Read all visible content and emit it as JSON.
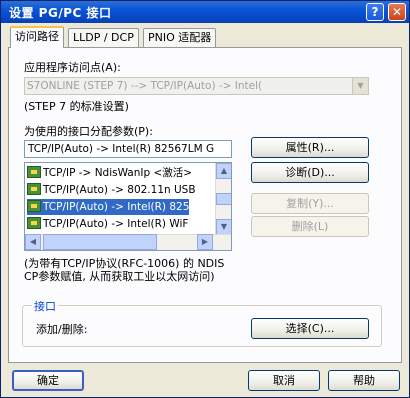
{
  "window": {
    "title": "设置 PG/PC 接口",
    "help_glyph": "?",
    "close_glyph": "✕"
  },
  "tabs": [
    {
      "label": "访问路径",
      "active": true
    },
    {
      "label": "LLDP / DCP",
      "active": false
    },
    {
      "label": "PNIO 适配器",
      "active": false
    }
  ],
  "access_point": {
    "label": "应用程序访问点(A):",
    "value": "S7ONLINE        (STEP 7)        --> TCP/IP(Auto) -> Intel(",
    "hint": "(STEP 7 的标准设置)"
  },
  "parameter": {
    "label": "为使用的接口分配参数(P):",
    "value": "TCP/IP(Auto) -> Intel(R) 82567LM G"
  },
  "interface_list": {
    "items": [
      {
        "text": "TCP/IP -> NdisWanIp  <激活>",
        "selected": false
      },
      {
        "text": "TCP/IP(Auto) -> 802.11n USB",
        "selected": false
      },
      {
        "text": "TCP/IP(Auto) -> Intel(R) 825",
        "selected": true
      },
      {
        "text": "TCP/IP(Auto) -> Intel(R) WiF",
        "selected": false
      }
    ]
  },
  "side_buttons": {
    "properties": "属性(R)...",
    "diagnostics": "诊断(D)...",
    "copy": "复制(Y)...",
    "delete": "删除(L)"
  },
  "description": "(为带有TCP/IP协议(RFC-1006) 的 NDIS CP参数赋值, 从而获取工业以太网访问)",
  "interface_group": {
    "title": "接口",
    "add_remove_label": "添加/删除:",
    "select_button": "选择(C)..."
  },
  "footer": {
    "ok": "确定",
    "cancel": "取消",
    "help": "帮助"
  }
}
